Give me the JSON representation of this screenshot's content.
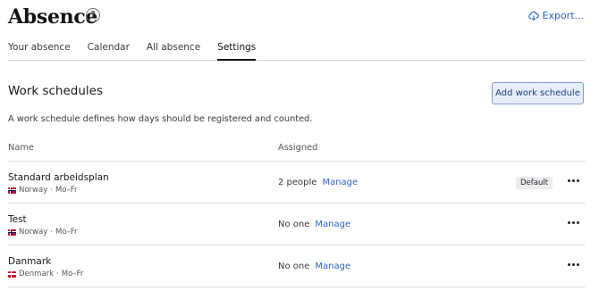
{
  "header": {
    "title": "Absence",
    "help_icon": "question-circle-icon",
    "export_label": "Export...",
    "export_icon": "cloud-download-icon"
  },
  "tabs": [
    {
      "label": "Your absence",
      "active": false
    },
    {
      "label": "Calendar",
      "active": false
    },
    {
      "label": "All absence",
      "active": false
    },
    {
      "label": "Settings",
      "active": true
    }
  ],
  "section": {
    "title": "Work schedules",
    "add_button": "Add work schedule",
    "description": "A work schedule defines how days should be registered and counted."
  },
  "table": {
    "columns": [
      "Name",
      "Assigned"
    ],
    "rows": [
      {
        "name": "Standard arbeidsplan",
        "country": "Norway",
        "days": "Mo–Fr",
        "assigned": "2 people",
        "manage": "Manage",
        "badge": "Default",
        "flag": "flag-norway-icon"
      },
      {
        "name": "Test",
        "country": "Norway",
        "days": "Mo–Fr",
        "assigned": "No one",
        "manage": "Manage",
        "badge": "",
        "flag": "flag-norway-icon"
      },
      {
        "name": "Danmark",
        "country": "Denmark",
        "days": "Mo–Fr",
        "assigned": "No one",
        "manage": "Manage",
        "badge": "",
        "flag": "flag-denmark-icon"
      }
    ]
  },
  "colors": {
    "accent": "#2e64c8",
    "button_bg": "#e7eefb",
    "button_border": "#7f9bd1"
  }
}
